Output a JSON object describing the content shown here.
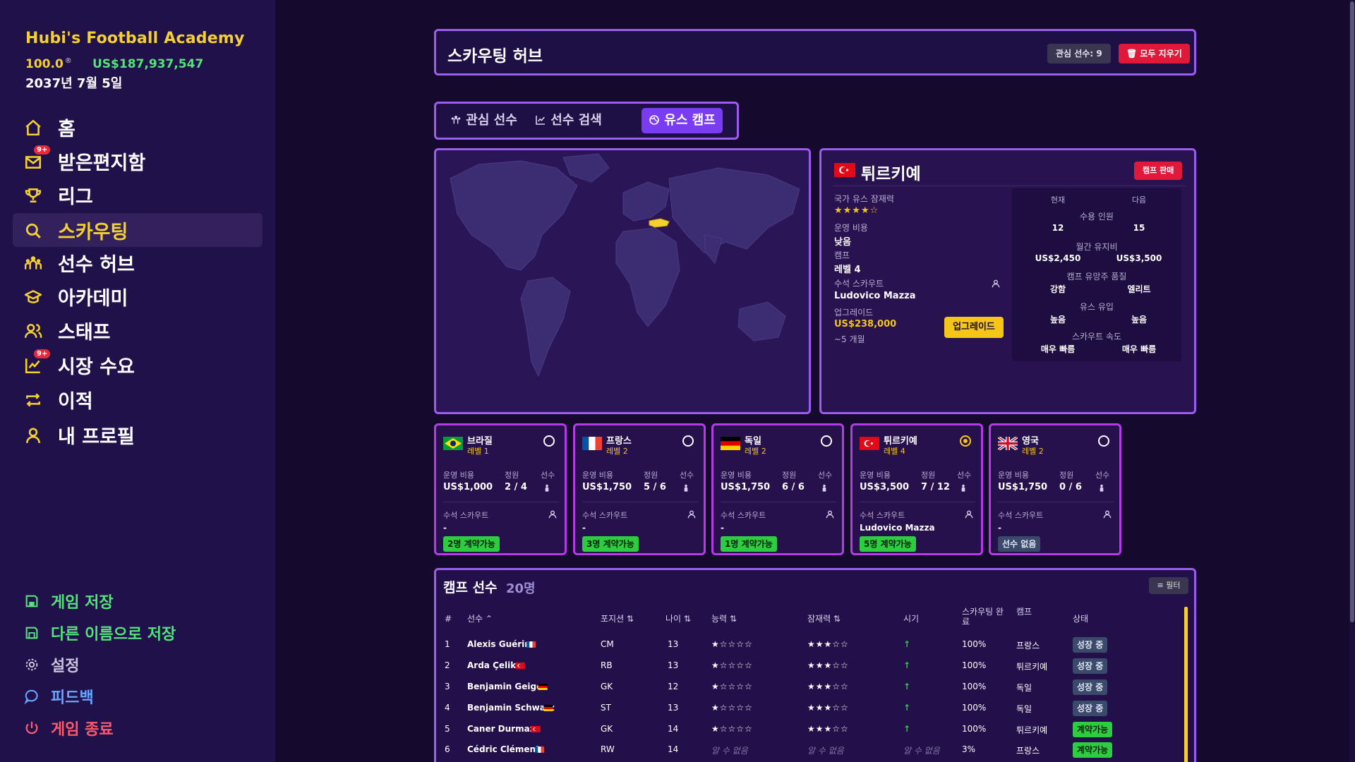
{
  "sidebar": {
    "club_name": "Hubi's Football Academy",
    "reputation": "100.0",
    "reputation_mark": "®",
    "money": "US$187,937,547",
    "date": "2037년 7월 5일",
    "items": [
      {
        "label": "홈",
        "icon": "home-icon"
      },
      {
        "label": "받은편지함",
        "icon": "mail-icon",
        "badge": "9+"
      },
      {
        "label": "리그",
        "icon": "trophy-icon"
      },
      {
        "label": "스카우팅",
        "icon": "search-icon",
        "active": true
      },
      {
        "label": "선수 허브",
        "icon": "players-icon"
      },
      {
        "label": "아카데미",
        "icon": "graduation-cap-icon"
      },
      {
        "label": "스태프",
        "icon": "staff-icon"
      },
      {
        "label": "시장 수요",
        "icon": "chart-icon",
        "badge": "9+"
      },
      {
        "label": "이적",
        "icon": "transfer-icon"
      },
      {
        "label": "내 프로필",
        "icon": "user-icon"
      }
    ],
    "bottom_items": [
      {
        "label": "게임 저장",
        "icon": "save-icon",
        "color": "#54e37a"
      },
      {
        "label": "다른 이름으로 저장",
        "icon": "save-as-icon",
        "color": "#54e37a"
      },
      {
        "label": "설정",
        "icon": "gear-icon",
        "color": "#c9c4da"
      },
      {
        "label": "피드백",
        "icon": "feedback-icon",
        "color": "#6aa6ff"
      },
      {
        "label": "게임 종료",
        "icon": "power-icon",
        "color": "#ff5a6a"
      }
    ]
  },
  "header": {
    "title": "스카우팅 허브",
    "watch_count": "관심 선수: 9",
    "clear_all": "모두 지우기"
  },
  "tabs": [
    {
      "label": "관심 선수",
      "icon": "players-icon"
    },
    {
      "label": "선수 검색",
      "icon": "chart-icon"
    },
    {
      "label": "유스 캠프",
      "icon": "globe-icon",
      "active": true
    }
  ],
  "country": {
    "name": "튀르키예",
    "sell_camp": "캠프 판매",
    "potential_label": "국가 유스 잠재력",
    "potential_stars": "★★★★☆",
    "cost_label": "운영 비용",
    "cost_value": "낮음",
    "camp_label": "캠프",
    "camp_value": "레벨 4",
    "head_scout_label": "수석 스카우트",
    "head_scout_value": "Ludovico Mazza",
    "upgrade_label": "업그레이드",
    "upgrade_cost": "US$238,000",
    "upgrade_time": "~5 개월",
    "upgrade_button": "업그레이드",
    "compare": {
      "current": "현재",
      "next": "다음",
      "rows": [
        {
          "title": "수용 인원",
          "current": "12",
          "next": "15"
        },
        {
          "title": "월간 유지비",
          "current": "US$2,450",
          "next": "US$3,500"
        },
        {
          "title": "캠프 유망주 품질",
          "current": "강함",
          "next": "엘리트"
        },
        {
          "title": "유스 유입",
          "current": "높음",
          "next": "높음"
        },
        {
          "title": "스카우트 속도",
          "current": "매우 빠름",
          "next": "매우 빠름"
        }
      ]
    }
  },
  "camps": [
    {
      "name": "브라질",
      "level": "레벨 1",
      "cost": "US$1,000",
      "capacity": "2 / 4",
      "scout": "-",
      "status": "2명 계약가능",
      "status_type": "ok",
      "selected": false
    },
    {
      "name": "프랑스",
      "level": "레벨 2",
      "cost": "US$1,750",
      "capacity": "5 / 6",
      "scout": "-",
      "status": "3명 계약가능",
      "status_type": "ok",
      "selected": false
    },
    {
      "name": "독일",
      "level": "레벨 2",
      "cost": "US$1,750",
      "capacity": "6 / 6",
      "scout": "-",
      "status": "1명 계약가능",
      "status_type": "ok",
      "selected": false
    },
    {
      "name": "튀르키예",
      "level": "레벨 4",
      "cost": "US$3,500",
      "capacity": "7 / 12",
      "scout": "Ludovico Mazza",
      "status": "5명 계약가능",
      "status_type": "ok",
      "selected": true
    },
    {
      "name": "영국",
      "level": "레벨 2",
      "cost": "US$1,750",
      "capacity": "0 / 6",
      "scout": "-",
      "status": "선수 없음",
      "status_type": "none",
      "selected": false
    }
  ],
  "camp_labels": {
    "cost": "운영 비용",
    "capacity": "정원",
    "players": "선수",
    "head_scout": "수석 스카우트"
  },
  "players_table": {
    "title": "캠프 선수",
    "count": "20명",
    "filter": "필터",
    "columns": [
      "#",
      "선수 ⌃",
      "포지션 ⇅",
      "나이 ⇅",
      "능력 ⇅",
      "잠재력 ⇅",
      "시기",
      "스카우팅 완료",
      "캠프",
      "상태"
    ],
    "rows": [
      {
        "n": "1",
        "name": "Alexis Guérin",
        "pos": "CM",
        "age": "13",
        "ability": "★☆☆☆☆",
        "potential": "★★★☆☆",
        "period": "↑",
        "scout": "100%",
        "camp": "프랑스",
        "status": "성장 중",
        "st": "grow"
      },
      {
        "n": "2",
        "name": "Arda Çelik",
        "pos": "RB",
        "age": "13",
        "ability": "★☆☆☆☆",
        "potential": "★★★☆☆",
        "period": "↑",
        "scout": "100%",
        "camp": "튀르키예",
        "status": "성장 중",
        "st": "grow"
      },
      {
        "n": "3",
        "name": "Benjamin Geiger",
        "pos": "GK",
        "age": "12",
        "ability": "★☆☆☆☆",
        "potential": "★★★☆☆",
        "period": "↑",
        "scout": "100%",
        "camp": "독일",
        "status": "성장 중",
        "st": "grow"
      },
      {
        "n": "4",
        "name": "Benjamin Schwarz",
        "pos": "ST",
        "age": "13",
        "ability": "★☆☆☆☆",
        "potential": "★★★☆☆",
        "period": "↑",
        "scout": "100%",
        "camp": "독일",
        "status": "성장 중",
        "st": "grow"
      },
      {
        "n": "5",
        "name": "Caner Durmaz",
        "pos": "GK",
        "age": "14",
        "ability": "★☆☆☆☆",
        "potential": "★★★☆☆",
        "period": "↑",
        "scout": "100%",
        "camp": "튀르키예",
        "status": "계약가능",
        "st": "ok"
      },
      {
        "n": "6",
        "name": "Cédric Clément",
        "pos": "RW",
        "age": "14",
        "ability": "알 수 없음",
        "potential": "알 수 없음",
        "period": "알 수 없음",
        "scout": "3%",
        "camp": "프랑스",
        "status": "계약가능",
        "st": "ok"
      }
    ]
  }
}
